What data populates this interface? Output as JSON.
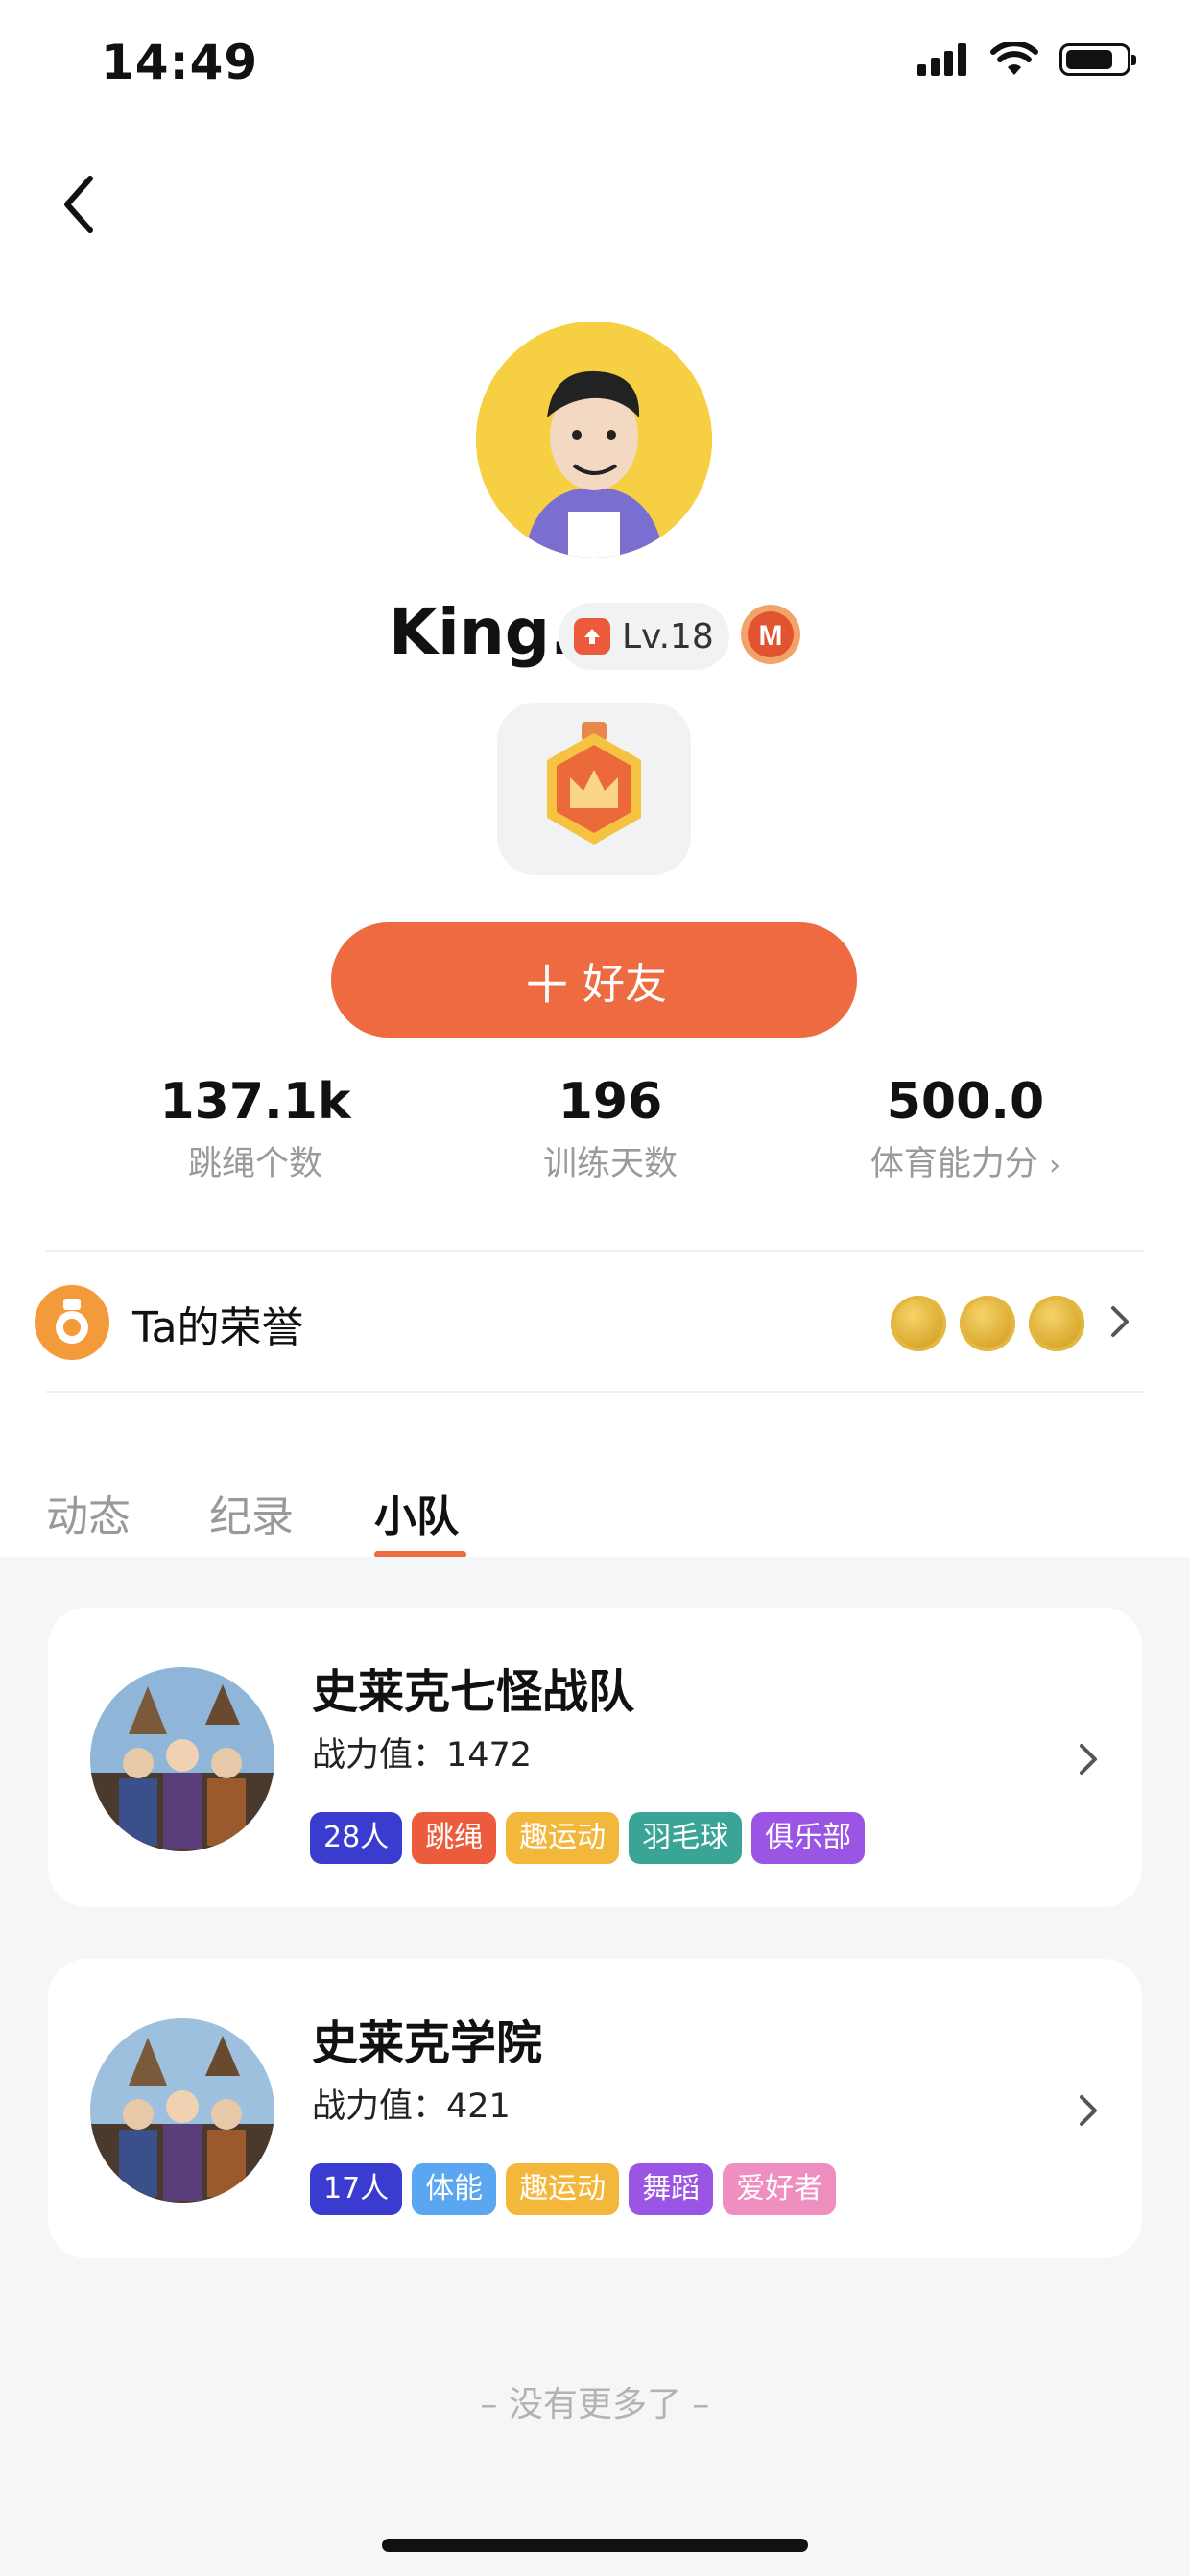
{
  "status_bar": {
    "time": "14:49"
  },
  "profile": {
    "name": "King.",
    "level": "Lv.18",
    "add_friend": "好友"
  },
  "stats": [
    {
      "value": "137.1k",
      "label": "跳绳个数"
    },
    {
      "value": "196",
      "label": "训练天数"
    },
    {
      "value": "500.0",
      "label": "体育能力分"
    }
  ],
  "honor": {
    "title": "Ta的荣誉"
  },
  "tabs": [
    {
      "label": "动态"
    },
    {
      "label": "纪录"
    },
    {
      "label": "小队"
    }
  ],
  "active_tab": "小队",
  "teams": [
    {
      "name": "史莱克七怪战队",
      "power": "战力值：1472",
      "tags": [
        {
          "text": "28人",
          "color": "#3a3ccf"
        },
        {
          "text": "跳绳",
          "color": "#ec5b3c"
        },
        {
          "text": "趣运动",
          "color": "#f3b73c"
        },
        {
          "text": "羽毛球",
          "color": "#3aa597"
        },
        {
          "text": "俱乐部",
          "color": "#9b55e4"
        }
      ]
    },
    {
      "name": "史莱克学院",
      "power": "战力值：421",
      "tags": [
        {
          "text": "17人",
          "color": "#3a3ccf"
        },
        {
          "text": "体能",
          "color": "#5aa6f1"
        },
        {
          "text": "趣运动",
          "color": "#f3b73c"
        },
        {
          "text": "舞蹈",
          "color": "#9b55e4"
        },
        {
          "text": "爱好者",
          "color": "#ee8fc0"
        }
      ]
    }
  ],
  "footer": {
    "no_more": "– 没有更多了 –"
  },
  "colors": {
    "accent": "#ee6a40",
    "avatar_bg": "#f6cf42"
  }
}
